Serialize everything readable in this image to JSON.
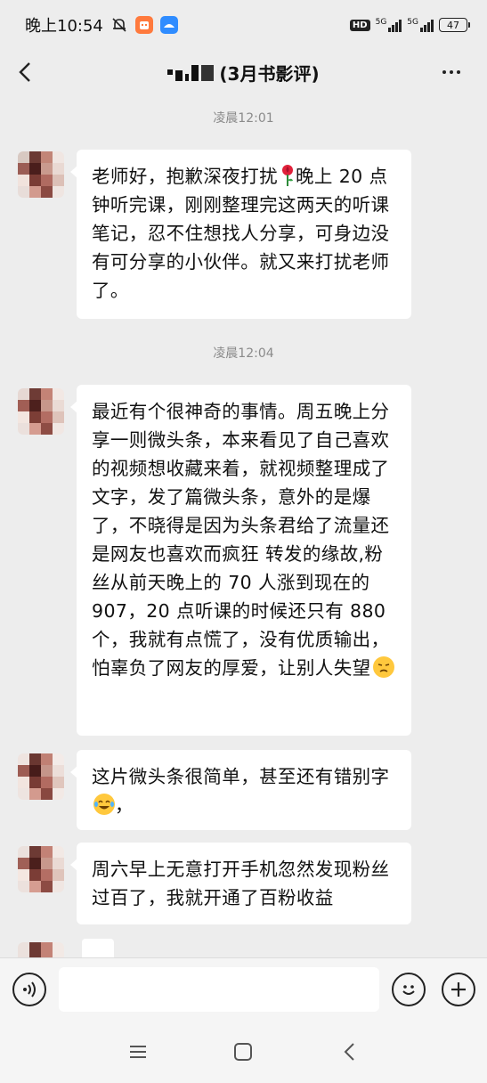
{
  "status_bar": {
    "time": "晚上10:54",
    "hd_label": "HD",
    "network_1": "5G",
    "network_2": "5G",
    "battery": "47",
    "icons": [
      "mute-bell-icon",
      "orange-app-icon",
      "blue-app-icon",
      "signal-icon",
      "signal-icon",
      "battery-icon"
    ]
  },
  "header": {
    "title": "(3月书影评)",
    "back_icon": "chevron-left-icon",
    "more_icon": "more-dots-icon"
  },
  "messages": [
    {
      "type": "time",
      "text": "凌晨12:01"
    },
    {
      "type": "incoming",
      "text": "老师好，抱歉深夜打扰",
      "emoji": "rose-emoji",
      "text2": "晚上 20 点钟听完课，刚刚整理完这两天的听课笔记，忍不住想找人分享，可身边没有可分享的小伙伴。就又来打扰老师了。"
    },
    {
      "type": "time",
      "text": "凌晨12:04"
    },
    {
      "type": "incoming",
      "text": "最近有个很神奇的事情。周五晚上分享一则微头条，本来看见了自己喜欢的视频想收藏来着，就视频整理成了文字，发了篇微头条，意外的是爆了，不晓得是因为头条君给了流量还是网友也喜欢而疯狂 转发的缘故,粉丝从前天晚上的 70 人涨到现在的 907，20 点听课的时候还只有 880 个，我就有点慌了，没有优质输出，怕辜负了网友的厚爱，让别人失望",
      "emoji": "worried-face-emoji"
    },
    {
      "type": "incoming",
      "text": "这片微头条很简单，甚至还有错别字",
      "emoji": "tears-of-joy-emoji",
      "text2": "，"
    },
    {
      "type": "incoming",
      "text": "周六早上无意打开手机忽然发现粉丝过百了，我就开通了百粉收益"
    }
  ],
  "input_bar": {
    "value": "",
    "voice_icon": "voice-icon",
    "emoji_icon": "smiley-icon",
    "plus_icon": "plus-icon"
  },
  "system_nav": {
    "icons": [
      "menu-icon",
      "home-icon",
      "back-icon"
    ]
  },
  "colors": {
    "background": "#ededed",
    "bubble": "#ffffff",
    "timestamp_text": "#8a8a8a"
  }
}
